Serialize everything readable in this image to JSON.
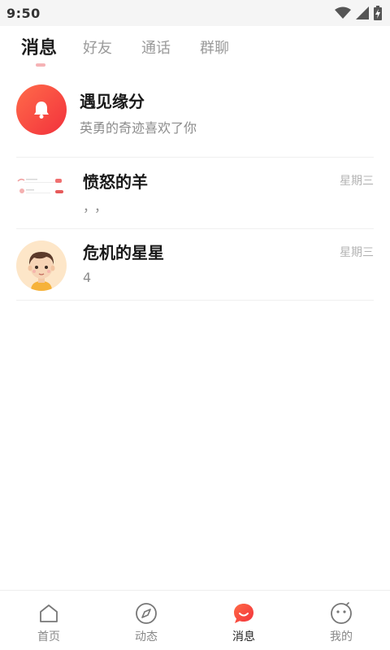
{
  "status_bar": {
    "time": "9:50",
    "icons": [
      "wifi-icon",
      "cellular-signal-icon",
      "battery-charging-icon"
    ]
  },
  "tabs": [
    {
      "label": "消息",
      "active": true
    },
    {
      "label": "好友",
      "active": false
    },
    {
      "label": "通话",
      "active": false
    },
    {
      "label": "群聊",
      "active": false
    }
  ],
  "conversations": [
    {
      "name": "遇见缘分",
      "preview": "英勇的奇迹喜欢了你",
      "time": "",
      "avatar": "bell-icon"
    },
    {
      "name": "愤怒的羊",
      "preview": "，，",
      "time": "星期三",
      "avatar": "screenshot-thumbnail"
    },
    {
      "name": "危机的星星",
      "preview": "4",
      "time": "星期三",
      "avatar": "cartoon-boy-avatar"
    }
  ],
  "bottom_nav": [
    {
      "label": "首页",
      "icon": "home-icon",
      "active": false
    },
    {
      "label": "动态",
      "icon": "compass-icon",
      "active": false
    },
    {
      "label": "消息",
      "icon": "chat-bubble-icon",
      "active": true
    },
    {
      "label": "我的",
      "icon": "smiley-face-icon",
      "active": false
    }
  ],
  "colors": {
    "accent": "#f2313c",
    "indicator": "#f6b3b6",
    "muted_text": "#8c8c8c"
  }
}
